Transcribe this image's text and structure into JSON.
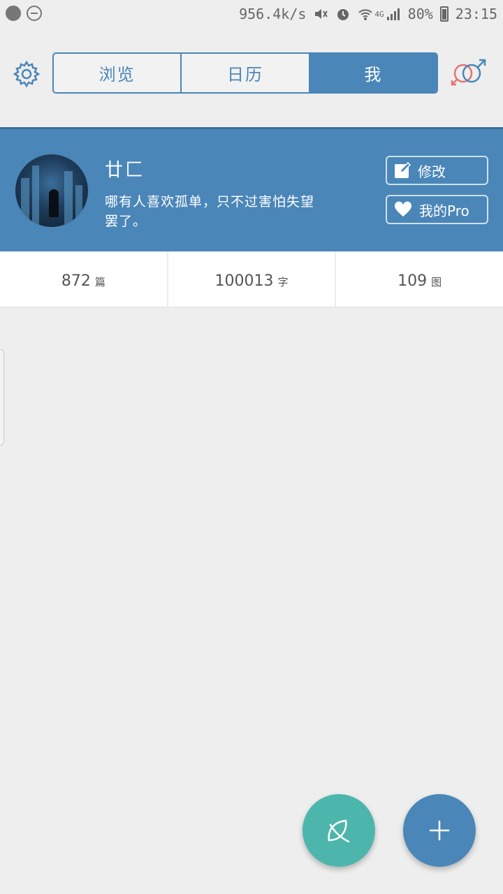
{
  "status_bar": {
    "speed": "956.4k/s",
    "network": "4G",
    "battery": "80%",
    "time": "23:15"
  },
  "nav": {
    "tabs": [
      {
        "label": "浏览"
      },
      {
        "label": "日历"
      },
      {
        "label": "我"
      }
    ],
    "active_tab": "我"
  },
  "profile": {
    "username": "廿匚",
    "bio": "哪有人喜欢孤单，只不过害怕失望罢了。",
    "edit_label": "修改",
    "pro_label": "我的Pro"
  },
  "stats": [
    {
      "value": "872",
      "unit": "篇"
    },
    {
      "value": "100013",
      "unit": "字"
    },
    {
      "value": "109",
      "unit": "图"
    }
  ],
  "colors": {
    "accent": "#4a86b8",
    "fab_leaf": "#4db6ac",
    "background": "#eeeeee"
  },
  "icons": {
    "settings": "gear-icon",
    "gender": "gender-icon",
    "edit": "edit-icon",
    "pro": "heart-icon",
    "fab_leaf": "leaf-icon",
    "fab_add": "plus-icon"
  }
}
